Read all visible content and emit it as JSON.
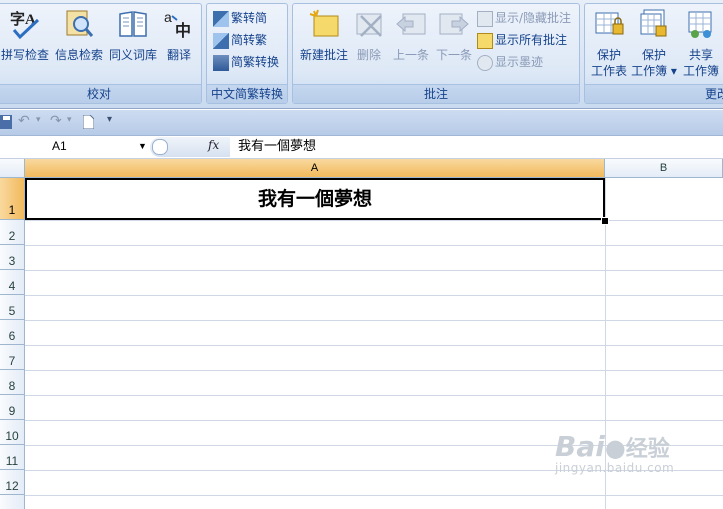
{
  "ribbon": {
    "proofing": {
      "label": "校对",
      "buttons": [
        {
          "label": "拼写检查",
          "icon": "spell-check-icon"
        },
        {
          "label": "信息检索",
          "icon": "research-icon"
        },
        {
          "label": "同义词库",
          "icon": "thesaurus-icon"
        },
        {
          "label": "翻译",
          "icon": "translate-icon"
        }
      ]
    },
    "chinese_conversion": {
      "label": "中文简繁转换",
      "buttons": [
        {
          "label": "繁转简",
          "icon": "trad-to-simp-icon"
        },
        {
          "label": "简转繁",
          "icon": "simp-to-trad-icon"
        },
        {
          "label": "简繁转换",
          "icon": "conversion-icon"
        }
      ]
    },
    "comments": {
      "label": "批注",
      "big": [
        {
          "label": "新建批注",
          "icon": "new-comment-icon",
          "enabled": true
        },
        {
          "label": "删除",
          "icon": "delete-comment-icon",
          "enabled": false
        },
        {
          "label": "上一条",
          "icon": "previous-comment-icon",
          "enabled": false
        },
        {
          "label": "下一条",
          "icon": "next-comment-icon",
          "enabled": false
        }
      ],
      "small": [
        {
          "label": "显示/隐藏批注",
          "enabled": false
        },
        {
          "label": "显示所有批注",
          "enabled": true
        },
        {
          "label": "显示墨迹",
          "enabled": false
        }
      ]
    },
    "changes": {
      "label": "更改",
      "buttons": [
        {
          "line1": "保护",
          "line2": "工作表",
          "icon": "protect-sheet-icon"
        },
        {
          "line1": "保护",
          "line2": "工作簿",
          "icon": "protect-workbook-icon"
        },
        {
          "line1": "共享",
          "line2": "工作簿",
          "icon": "share-workbook-icon"
        }
      ]
    }
  },
  "formula_bar": {
    "name_box": "A1",
    "fx": "fx",
    "value": "我有一個夢想"
  },
  "sheet": {
    "columns": [
      "A",
      "B"
    ],
    "rows": [
      "1",
      "2",
      "3",
      "4",
      "5",
      "6",
      "7",
      "8",
      "9",
      "10",
      "11",
      "12"
    ],
    "cell_a1": "我有一個夢想"
  },
  "watermark": {
    "brand": "Bai",
    "brand_suffix": "经验",
    "url": "jingyan.baidu.com"
  },
  "colors": {
    "ribbon_text": "#15428b",
    "active_header": "#f1b95c",
    "gridline": "#d0d7e5"
  }
}
